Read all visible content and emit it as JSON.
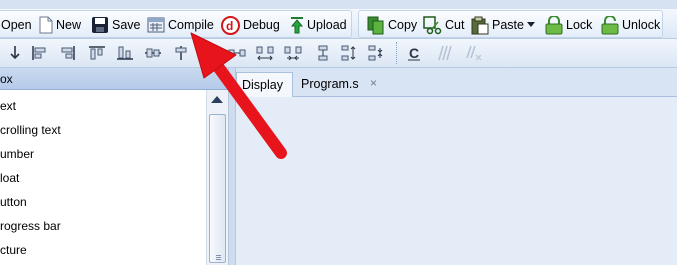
{
  "toolbar": {
    "open_label": "Open",
    "new_label": "New",
    "save_label": "Save",
    "compile_label": "Compile",
    "debug_label": "Debug",
    "upload_label": "Upload",
    "copy_label": "Copy",
    "cut_label": "Cut",
    "paste_label": "Paste",
    "lock_label": "Lock",
    "unlock_label": "Unlock"
  },
  "toolbox": {
    "header": "ox",
    "items": [
      {
        "label": "ext"
      },
      {
        "label": "crolling text"
      },
      {
        "label": "umber"
      },
      {
        "label": "loat"
      },
      {
        "label": "utton"
      },
      {
        "label": "rogress bar"
      },
      {
        "label": "cture"
      }
    ]
  },
  "tabs": [
    {
      "label": "Display",
      "active": true
    },
    {
      "label": "Program.s",
      "active": false
    }
  ],
  "tab_close_glyph": "×",
  "colors": {
    "annotation_arrow": "#e8141c",
    "toolbar_bg": "#dde8f6",
    "workspace_bg": "#e4ecf7"
  }
}
